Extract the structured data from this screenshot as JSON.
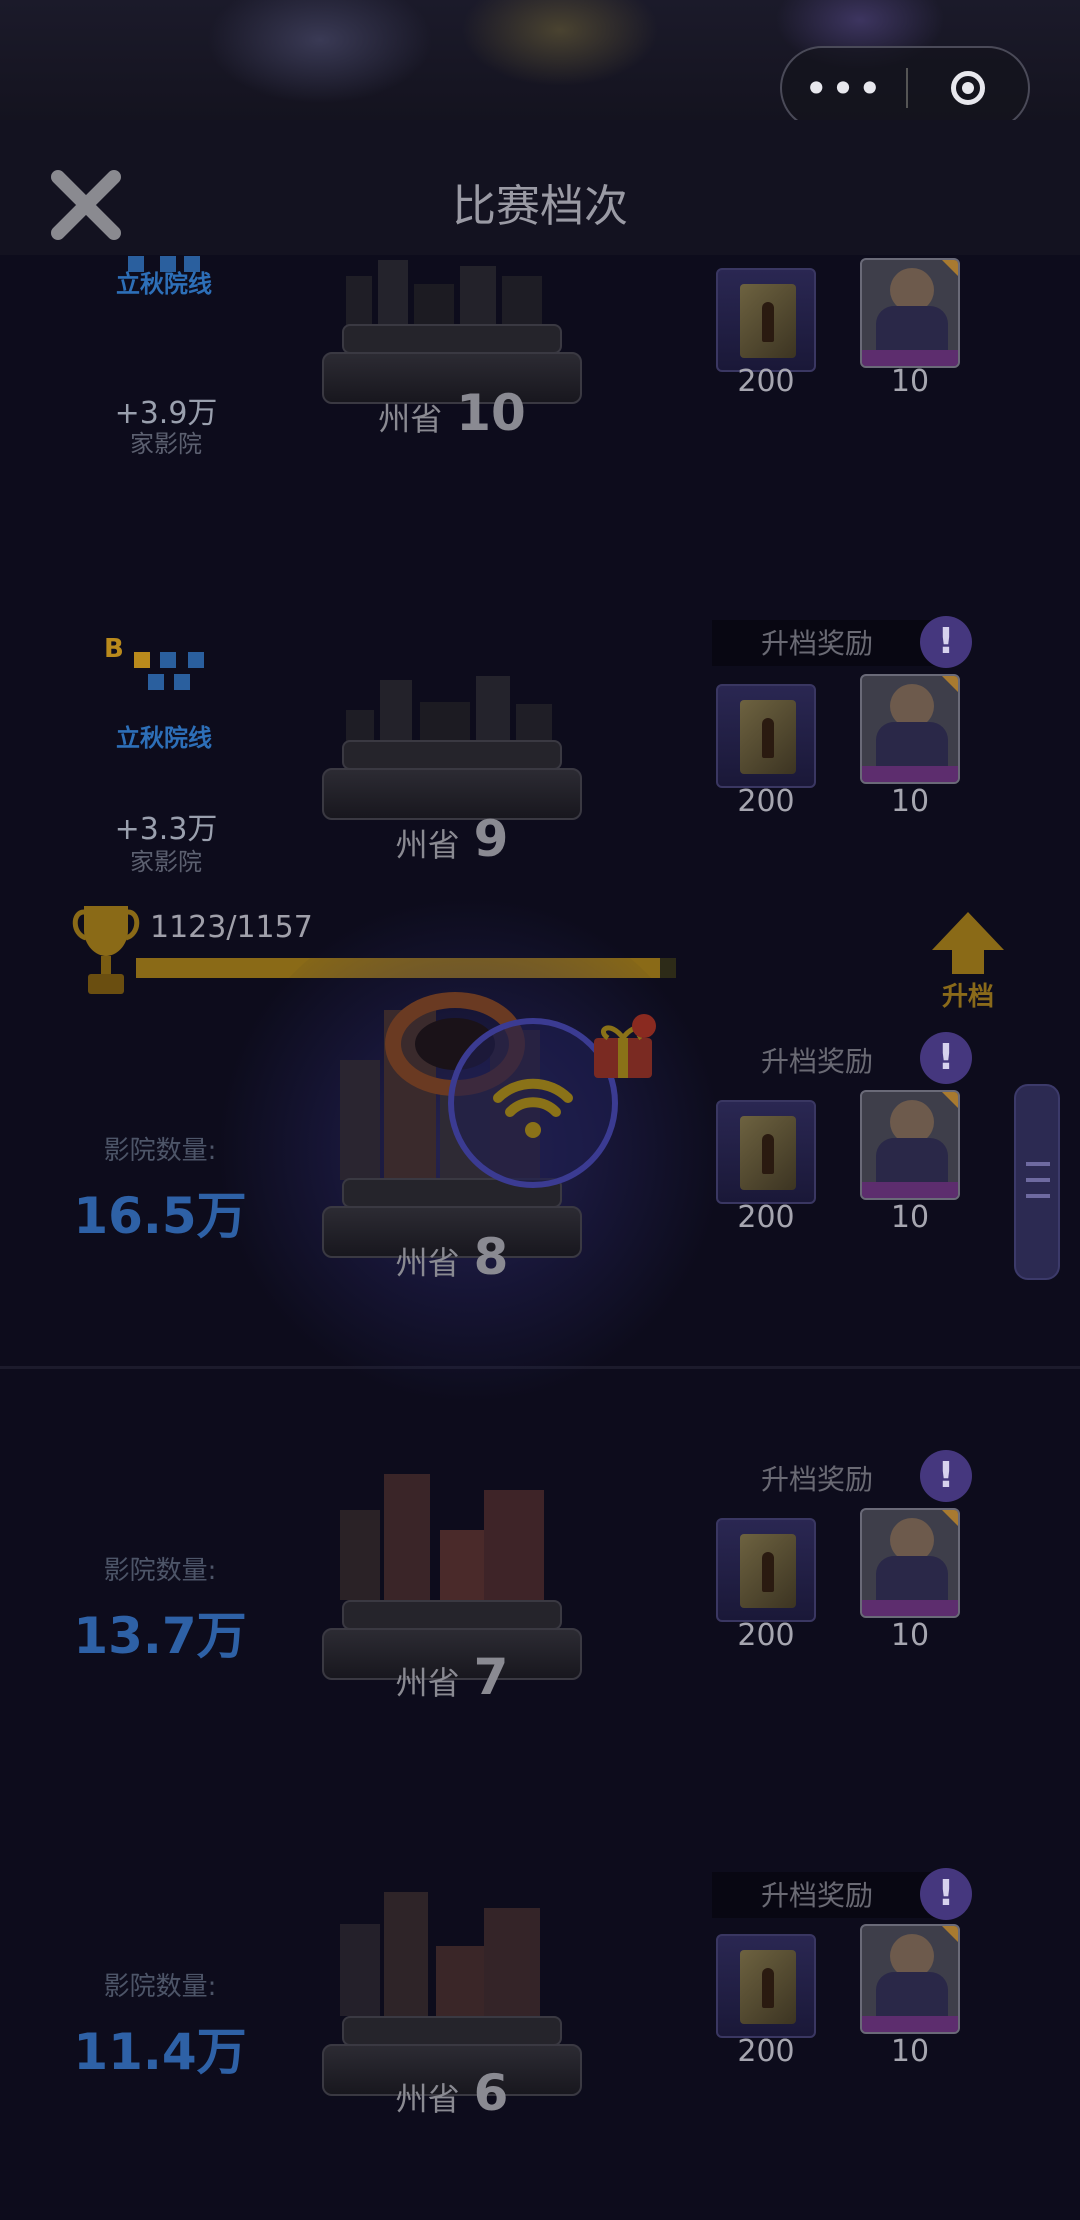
{
  "header": {
    "title": "比赛档次",
    "more_label": "•••"
  },
  "progress": {
    "text": "1123/1157",
    "current": 1123,
    "max": 1157
  },
  "upgrade": {
    "label": "升档"
  },
  "tiers": [
    {
      "level_prefix": "州省",
      "level_num": "10",
      "logo_text": "立秋院线",
      "delta": "+3.9万",
      "delta_sub": "家影院",
      "reward_header": "",
      "reward_items": [
        "200",
        "10"
      ]
    },
    {
      "level_prefix": "州省",
      "level_num": "9",
      "logo_text": "立秋院线",
      "logo_badge": "B",
      "delta": "+3.3万",
      "delta_sub": "家影院",
      "reward_header": "升档奖励",
      "reward_items": [
        "200",
        "10"
      ]
    },
    {
      "level_prefix": "州省",
      "level_num": "8",
      "count_label": "影院数量:",
      "count_value": "16.5万",
      "reward_header": "升档奖励",
      "reward_items": [
        "200",
        "10"
      ]
    },
    {
      "level_prefix": "州省",
      "level_num": "7",
      "count_label": "影院数量:",
      "count_value": "13.7万",
      "reward_header": "升档奖励",
      "reward_items": [
        "200",
        "10"
      ]
    },
    {
      "level_prefix": "州省",
      "level_num": "6",
      "count_label": "影院数量:",
      "count_value": "11.4万",
      "reward_header": "升档奖励",
      "reward_items": [
        "200",
        "10"
      ]
    }
  ],
  "colors": {
    "accent_gold": "#8a6a17",
    "count_blue": "#2e61a6",
    "info_purple": "#45377e"
  },
  "icons": {
    "close": "close-icon",
    "info": "info-icon",
    "trophy": "trophy-icon",
    "upgrade": "arrow-up-icon",
    "signal": "wifi-signal-icon",
    "gift": "gift-icon",
    "capsule_close": "target-icon"
  }
}
